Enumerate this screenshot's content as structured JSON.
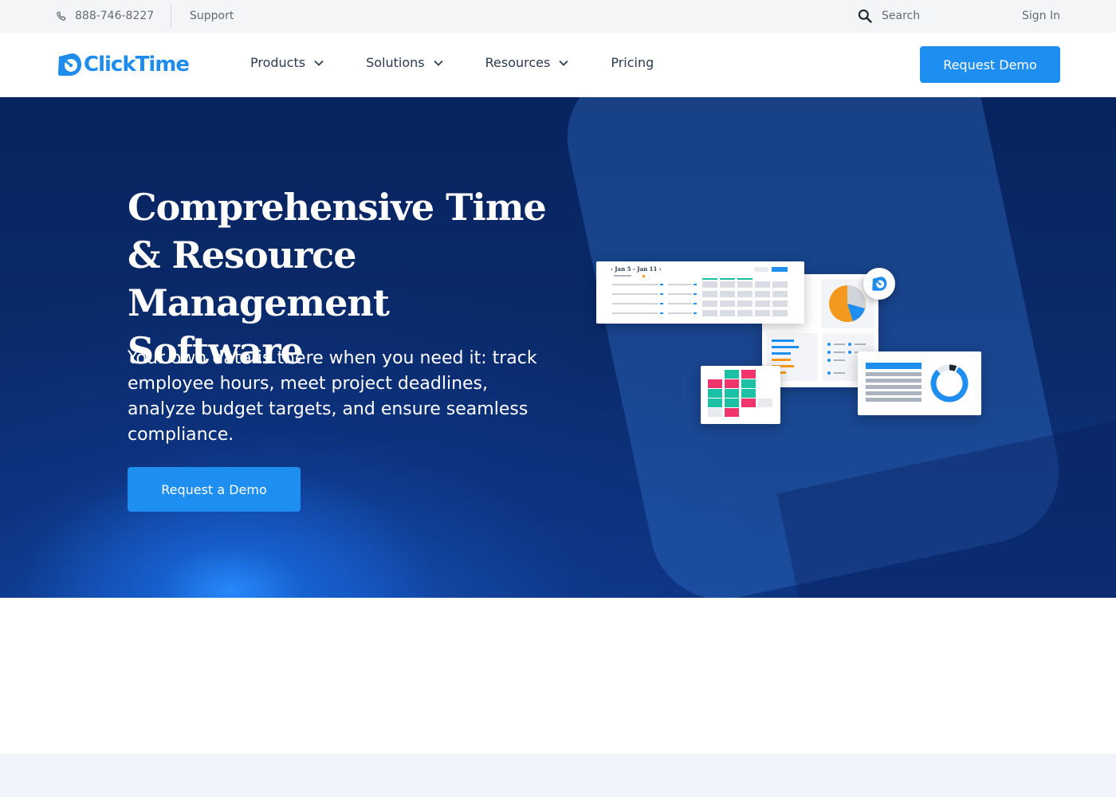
{
  "utility_bar": {
    "phone": "888-746-8227",
    "support": "Support",
    "search_label": "Search",
    "sign_in": "Sign In"
  },
  "nav": {
    "logo_text": "ClickTime",
    "items": [
      {
        "label": "Products",
        "has_dropdown": true
      },
      {
        "label": "Solutions",
        "has_dropdown": true
      },
      {
        "label": "Resources",
        "has_dropdown": true
      },
      {
        "label": "Pricing",
        "has_dropdown": false
      }
    ],
    "cta": "Request Demo"
  },
  "hero": {
    "title": "Comprehensive Time & Resource Management Software",
    "subtitle": "Your own data is there when you need it: track employee hours, meet project deadlines, analyze budget targets, and ensure seamless compliance.",
    "cta": "Request a Demo",
    "illustration": {
      "timesheet_range": "Jan 5 - Jan 11"
    }
  },
  "colors": {
    "brand_blue": "#1e8ff0",
    "hero_navy": "#0a2a6a",
    "nav_text": "#2b3a4e",
    "util_text": "#646b74",
    "chart_orange": "#f39a1e",
    "chart_pink": "#f0356d",
    "chart_teal": "#1cc1a5"
  },
  "icons": [
    "phone-icon",
    "search-icon",
    "chevron-down-icon",
    "clicktime-logo-icon"
  ]
}
